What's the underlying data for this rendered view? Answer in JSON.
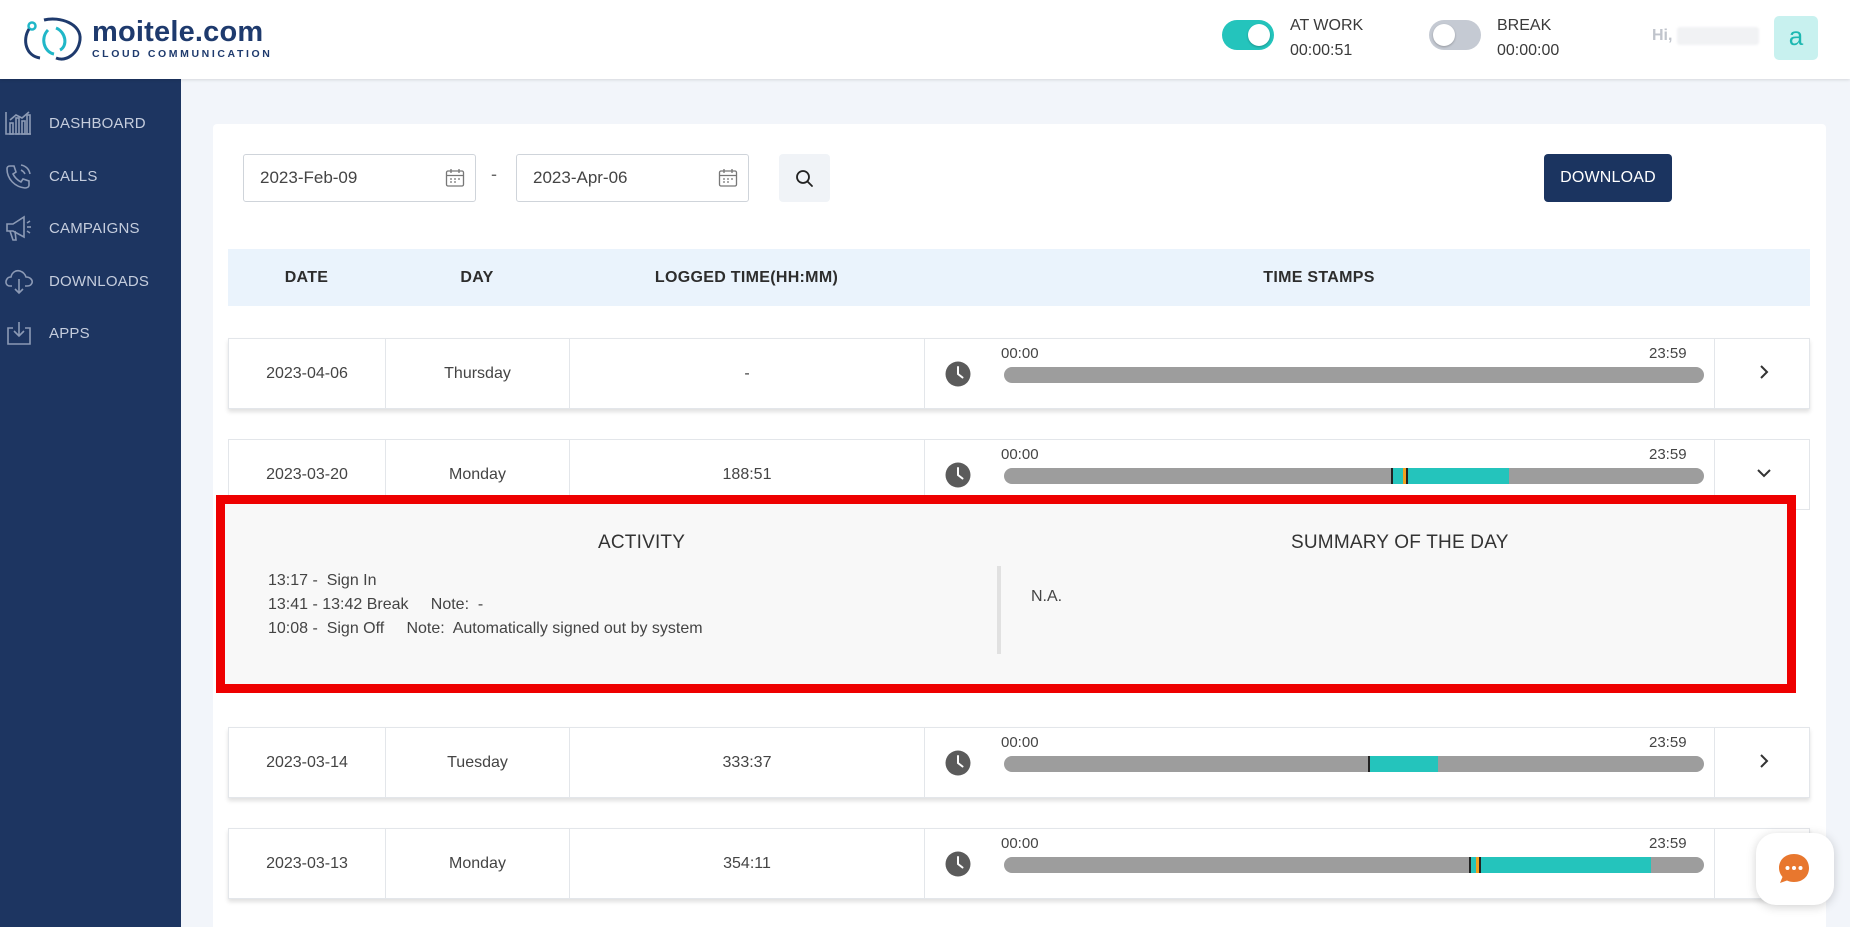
{
  "header": {
    "brand_name": "moitele.com",
    "brand_tagline": "CLOUD COMMUNICATION",
    "at_work_label": "AT WORK",
    "at_work_timer": "00:00:51",
    "break_label": "BREAK",
    "break_timer": "00:00:00",
    "greeting": "Hi,",
    "avatar_letter": "a"
  },
  "sidebar": {
    "items": [
      {
        "label": "DASHBOARD",
        "icon": "bar-chart-icon"
      },
      {
        "label": "CALLS",
        "icon": "phone-icon"
      },
      {
        "label": "CAMPAIGNS",
        "icon": "megaphone-icon"
      },
      {
        "label": "DOWNLOADS",
        "icon": "cloud-download-icon"
      },
      {
        "label": "APPS",
        "icon": "tray-download-icon"
      }
    ]
  },
  "filters": {
    "from_date": "2023-Feb-09",
    "separator": "-",
    "to_date": "2023-Apr-06",
    "download_label": "DOWNLOAD"
  },
  "table": {
    "columns": [
      "DATE",
      "DAY",
      "LOGGED TIME(HH:MM)",
      "TIME STAMPS"
    ],
    "timeline_start": "00:00",
    "timeline_end": "23:59",
    "rows": [
      {
        "date": "2023-04-06",
        "day": "Thursday",
        "logged": "-",
        "expanded": false
      },
      {
        "date": "2023-03-20",
        "day": "Monday",
        "logged": "188:51",
        "expanded": true
      },
      {
        "date": "2023-03-14",
        "day": "Tuesday",
        "logged": "333:37",
        "expanded": false
      },
      {
        "date": "2023-03-13",
        "day": "Monday",
        "logged": "354:11",
        "expanded": false
      }
    ]
  },
  "detail": {
    "activity_title": "ACTIVITY",
    "summary_title": "SUMMARY OF THE DAY",
    "activity_lines": [
      "13:17 -  Sign In",
      "13:41 - 13:42 Break     Note:  -",
      "10:08 -  Sign Off     Note:  Automatically signed out by system"
    ],
    "summary_text": "N.A."
  },
  "colors": {
    "sidebar_bg": "#1d3561",
    "accent_teal": "#24c4bc",
    "break_orange": "#f0a020",
    "bar_grey": "#9d9d9d",
    "highlight_red": "#ee0000"
  }
}
